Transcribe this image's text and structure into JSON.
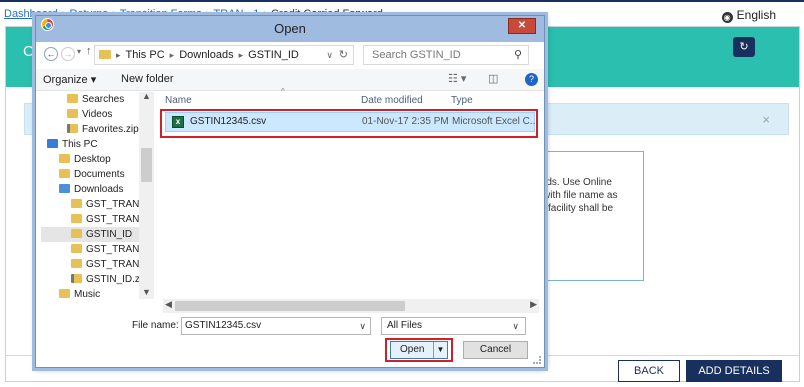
{
  "page": {
    "breadcrumb": [
      "Dashboard",
      "Returns",
      "Transition Forms",
      "TRAN - 1",
      "Credit Carried Forward"
    ],
    "language": "English",
    "title_initial": "C",
    "info_lines": [
      "rds. Use Online",
      "with file name as",
      "l facility shall be",
      "v"
    ],
    "back_label": "BACK",
    "add_details_label": "ADD DETAILS",
    "alert_close": "×",
    "colors": {
      "teal": "#2abfae",
      "navy": "#17305e",
      "highlight": "#d0202a"
    }
  },
  "dialog": {
    "title": "Open",
    "close": "✕",
    "path": [
      "This PC",
      "Downloads",
      "GSTIN_ID"
    ],
    "search_placeholder": "Search GSTIN_ID",
    "toolbar": {
      "organize": "Organize ▾",
      "new_folder": "New folder"
    },
    "tree": [
      {
        "label": "Searches",
        "icon": "folder"
      },
      {
        "label": "Videos",
        "icon": "folder"
      },
      {
        "label": "Favorites.zip",
        "icon": "zip"
      },
      {
        "label": "This PC",
        "icon": "pc"
      },
      {
        "label": "Desktop",
        "icon": "folder"
      },
      {
        "label": "Documents",
        "icon": "folder"
      },
      {
        "label": "Downloads",
        "icon": "downloads"
      },
      {
        "label": "GST_TRAN!",
        "icon": "folder"
      },
      {
        "label": "GST_TRAN!",
        "icon": "folder"
      },
      {
        "label": "GSTIN_ID",
        "icon": "folder",
        "selected": true
      },
      {
        "label": "GST_TRAN!",
        "icon": "folder"
      },
      {
        "label": "GST_TRAN!",
        "icon": "folder"
      },
      {
        "label": "GSTIN_ID.zi",
        "icon": "zip"
      },
      {
        "label": "Music",
        "icon": "music"
      }
    ],
    "columns": {
      "name": "Name",
      "date": "Date modified",
      "type": "Type"
    },
    "files": [
      {
        "name": "GSTIN12345.csv",
        "date": "01-Nov-17 2:35 PM",
        "type": "Microsoft Excel C..."
      }
    ],
    "filename_label": "File name:",
    "filename_value": "GSTIN12345.csv",
    "filetype": "All Files",
    "open_label": "Open",
    "cancel_label": "Cancel"
  }
}
